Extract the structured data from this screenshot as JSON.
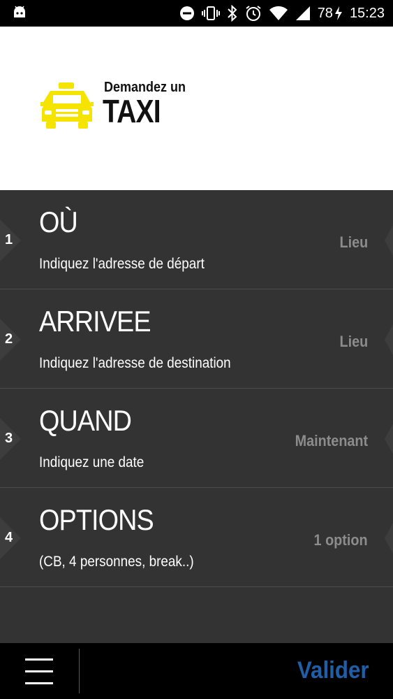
{
  "status_bar": {
    "battery": "78",
    "time": "15:23"
  },
  "header": {
    "logo_line1": "Demandez un",
    "logo_line2": "TAXI",
    "brand_color": "#f5e400"
  },
  "steps": [
    {
      "number": "1",
      "title": "OÙ",
      "subtitle": "Indiquez l'adresse de départ",
      "value": "Lieu"
    },
    {
      "number": "2",
      "title": "ARRIVEE",
      "subtitle": "Indiquez l'adresse de destination",
      "value": "Lieu"
    },
    {
      "number": "3",
      "title": "QUAND",
      "subtitle": "Indiquez une date",
      "value": "Maintenant"
    },
    {
      "number": "4",
      "title": "OPTIONS",
      "subtitle": "(CB, 4 personnes, break..)",
      "value": "1 option"
    }
  ],
  "bottom_bar": {
    "validate_label": "Valider",
    "accent_color": "#1f5fa8"
  },
  "icons": [
    "android-icon",
    "do-not-disturb-icon",
    "vibrate-icon",
    "bluetooth-icon",
    "alarm-icon",
    "wifi-icon",
    "signal-icon",
    "charging-icon",
    "taxi-icon",
    "menu-icon"
  ]
}
